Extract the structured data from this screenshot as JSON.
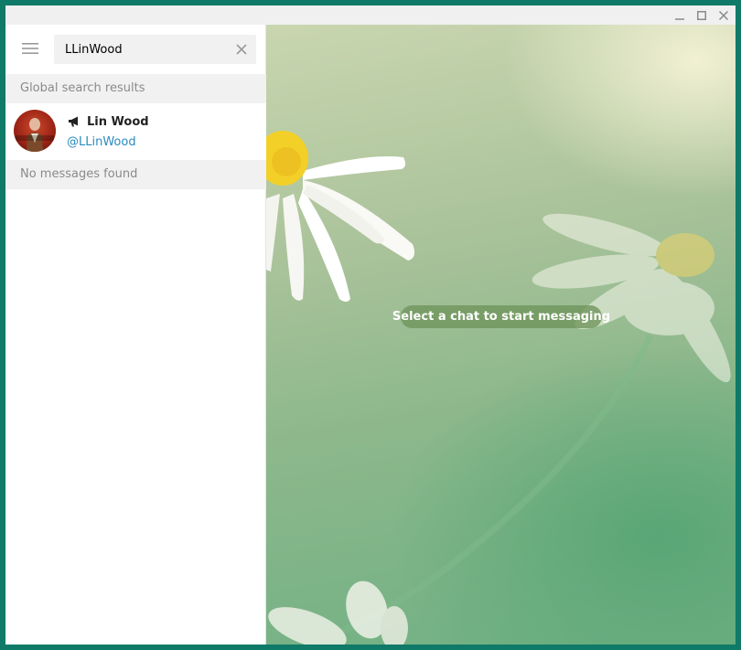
{
  "window": {
    "controls": {
      "minimize_icon": "minimize-icon",
      "maximize_icon": "maximize-icon",
      "close_icon": "close-icon"
    }
  },
  "sidebar": {
    "menu_icon": "hamburger-menu-icon",
    "search": {
      "value": "LLinWood",
      "clear_icon": "close-icon"
    },
    "global_results_header": "Global search results",
    "results": [
      {
        "name": "Lin Wood",
        "type_icon": "megaphone-icon",
        "handle": "@LLinWood"
      }
    ],
    "messages_header": "No messages found"
  },
  "chat": {
    "placeholder": "Select a chat to start messaging"
  },
  "colors": {
    "frame": "#0f7a67",
    "link": "#2a8bc0",
    "section_bg": "#f1f1f1"
  }
}
